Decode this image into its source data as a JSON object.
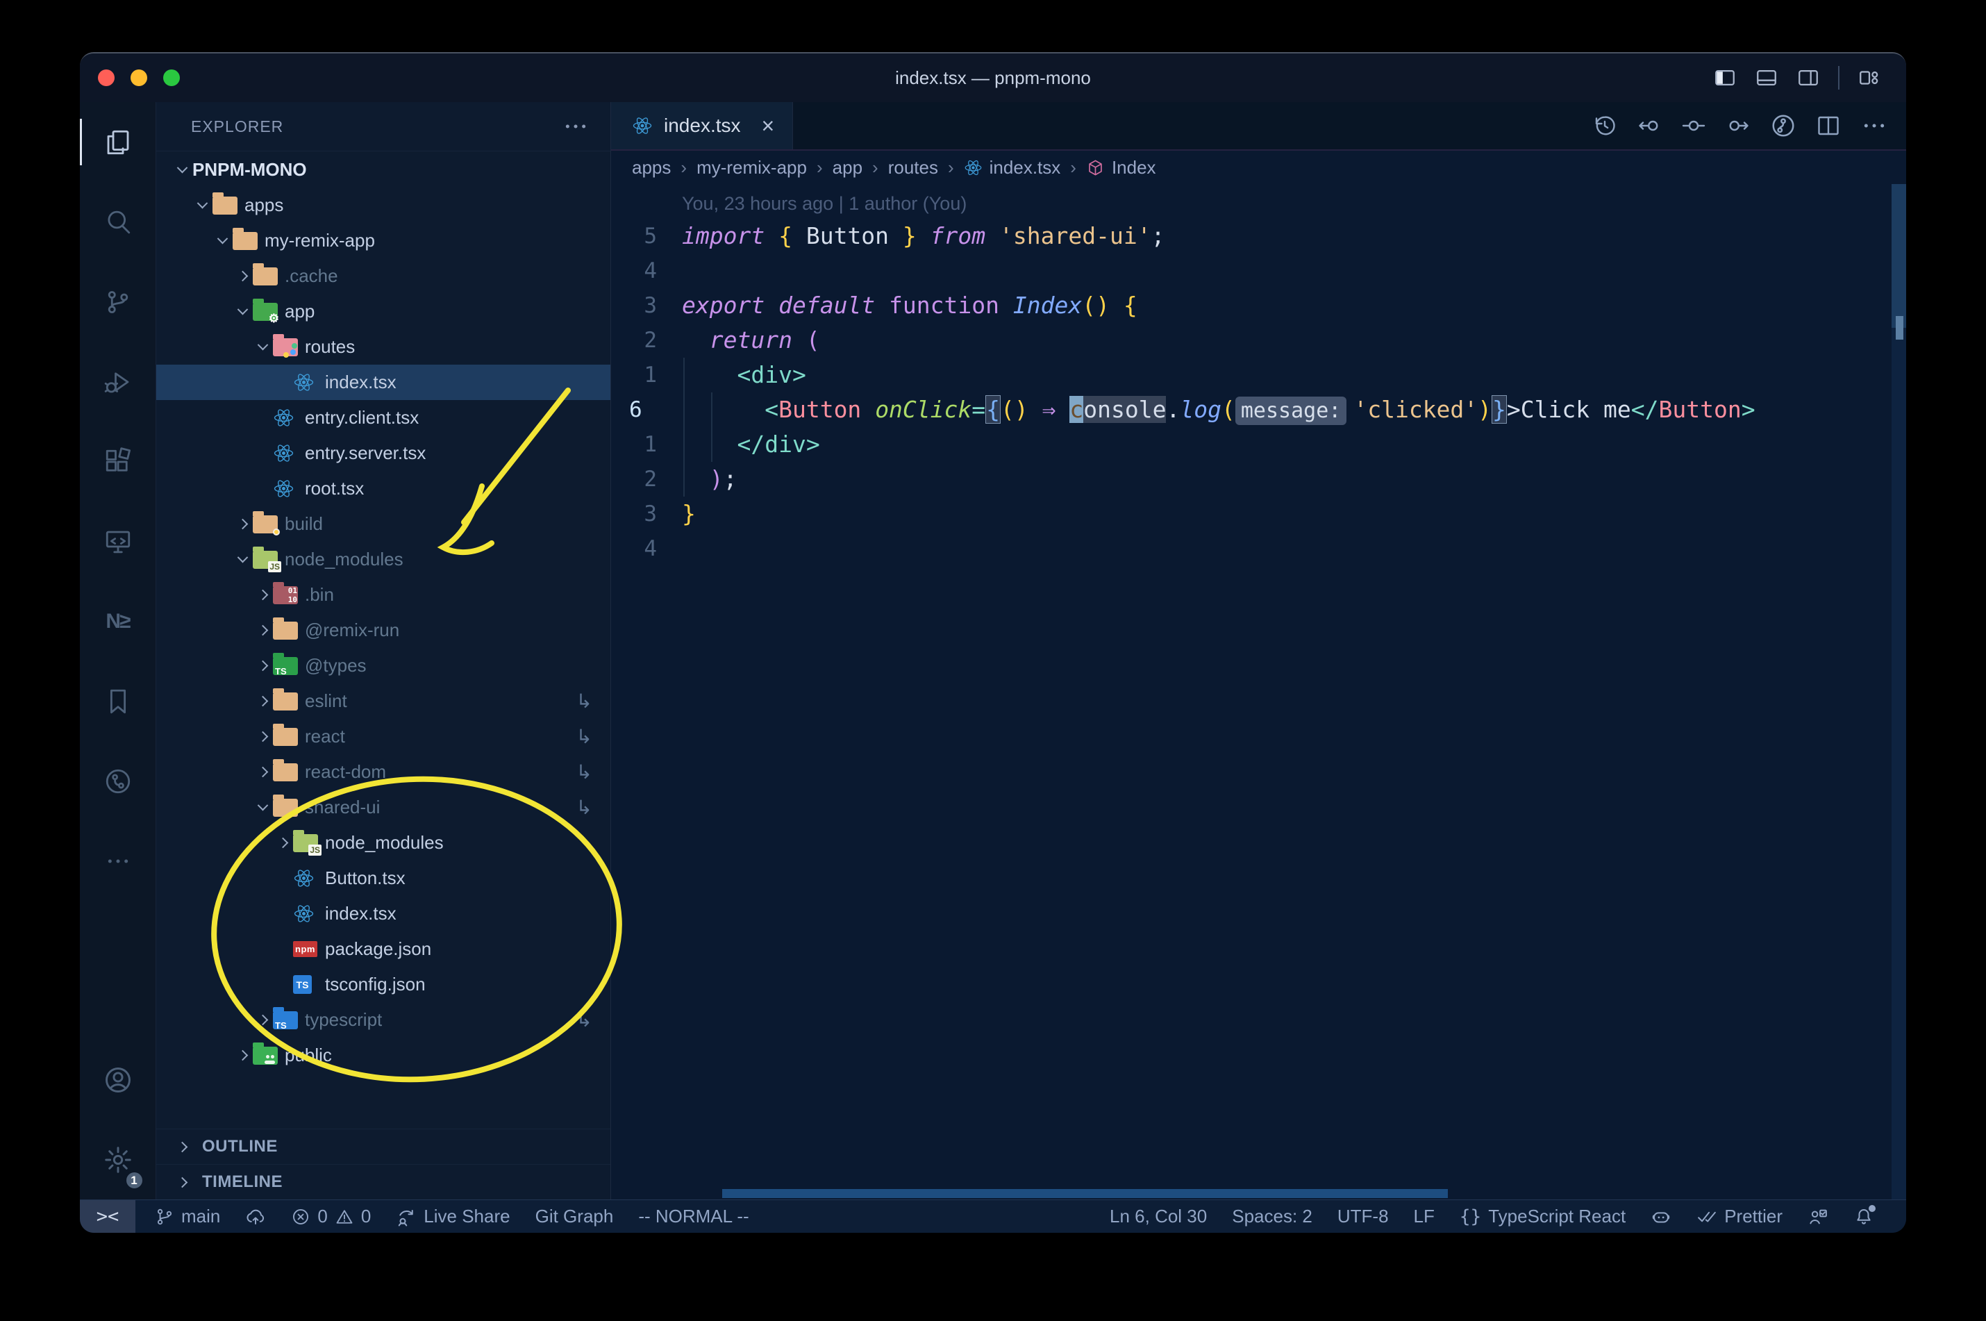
{
  "window": {
    "title": "index.tsx — pnpm-mono"
  },
  "titlebar": {
    "traffic_lights": [
      {
        "name": "close",
        "color": "#ff5f57"
      },
      {
        "name": "minimize",
        "color": "#febc2e"
      },
      {
        "name": "zoom",
        "color": "#2ac840"
      }
    ],
    "controls": [
      "layout-sidebar-left",
      "layout-panel",
      "layout-sidebar-right",
      "sep",
      "customize-layout"
    ]
  },
  "activity_bar": {
    "top": [
      {
        "name": "explorer",
        "active": true
      },
      {
        "name": "search",
        "active": false
      },
      {
        "name": "source-control",
        "active": false
      },
      {
        "name": "run-debug",
        "active": false
      },
      {
        "name": "extensions",
        "active": false
      },
      {
        "name": "remote-explorer",
        "active": false
      },
      {
        "name": "nx-console",
        "active": false
      },
      {
        "name": "bookmarks",
        "active": false
      },
      {
        "name": "gitlens",
        "active": false
      },
      {
        "name": "more",
        "active": false
      }
    ],
    "bottom": [
      {
        "name": "account"
      },
      {
        "name": "settings",
        "badge": "1"
      }
    ]
  },
  "explorer": {
    "title": "EXPLORER",
    "project": "PNPM-MONO",
    "tree": [
      {
        "label": "apps",
        "depth": 1,
        "chev": "open",
        "icon": "folder-tan",
        "dim": false,
        "sel": false,
        "symlink": false
      },
      {
        "label": "my-remix-app",
        "depth": 2,
        "chev": "open",
        "icon": "folder-tan",
        "dim": false,
        "sel": false,
        "symlink": false
      },
      {
        "label": ".cache",
        "depth": 3,
        "chev": "closed",
        "icon": "folder-tan",
        "dim": true,
        "sel": false,
        "symlink": false
      },
      {
        "label": "app",
        "depth": 3,
        "chev": "open",
        "icon": "folder-app",
        "dim": false,
        "sel": false,
        "symlink": false
      },
      {
        "label": "routes",
        "depth": 4,
        "chev": "open",
        "icon": "folder-routes",
        "dim": false,
        "sel": false,
        "symlink": false
      },
      {
        "label": "index.tsx",
        "depth": 5,
        "chev": "none",
        "icon": "react",
        "dim": false,
        "sel": true,
        "symlink": false
      },
      {
        "label": "entry.client.tsx",
        "depth": 4,
        "chev": "none",
        "icon": "react",
        "dim": false,
        "sel": false,
        "symlink": false
      },
      {
        "label": "entry.server.tsx",
        "depth": 4,
        "chev": "none",
        "icon": "react",
        "dim": false,
        "sel": false,
        "symlink": false
      },
      {
        "label": "root.tsx",
        "depth": 4,
        "chev": "none",
        "icon": "react",
        "dim": false,
        "sel": false,
        "symlink": false
      },
      {
        "label": "build",
        "depth": 3,
        "chev": "closed",
        "icon": "folder-build",
        "dim": true,
        "sel": false,
        "symlink": false
      },
      {
        "label": "node_modules",
        "depth": 3,
        "chev": "open",
        "icon": "folder-node",
        "dim": true,
        "sel": false,
        "symlink": false
      },
      {
        "label": ".bin",
        "depth": 4,
        "chev": "closed",
        "icon": "folder-bin",
        "dim": true,
        "sel": false,
        "symlink": false
      },
      {
        "label": "@remix-run",
        "depth": 4,
        "chev": "closed",
        "icon": "folder-tan",
        "dim": true,
        "sel": false,
        "symlink": false
      },
      {
        "label": "@types",
        "depth": 4,
        "chev": "closed",
        "icon": "folder-types",
        "dim": true,
        "sel": false,
        "symlink": false
      },
      {
        "label": "eslint",
        "depth": 4,
        "chev": "closed",
        "icon": "folder-tan",
        "dim": true,
        "sel": false,
        "symlink": true
      },
      {
        "label": "react",
        "depth": 4,
        "chev": "closed",
        "icon": "folder-tan",
        "dim": true,
        "sel": false,
        "symlink": true
      },
      {
        "label": "react-dom",
        "depth": 4,
        "chev": "closed",
        "icon": "folder-tan",
        "dim": true,
        "sel": false,
        "symlink": true
      },
      {
        "label": "shared-ui",
        "depth": 4,
        "chev": "open",
        "icon": "folder-tan",
        "dim": true,
        "sel": false,
        "symlink": true
      },
      {
        "label": "node_modules",
        "depth": 5,
        "chev": "closed",
        "icon": "folder-node",
        "dim": false,
        "sel": false,
        "symlink": false
      },
      {
        "label": "Button.tsx",
        "depth": 5,
        "chev": "none",
        "icon": "react",
        "dim": false,
        "sel": false,
        "symlink": false
      },
      {
        "label": "index.tsx",
        "depth": 5,
        "chev": "none",
        "icon": "react",
        "dim": false,
        "sel": false,
        "symlink": false
      },
      {
        "label": "package.json",
        "depth": 5,
        "chev": "none",
        "icon": "npm",
        "dim": false,
        "sel": false,
        "symlink": false
      },
      {
        "label": "tsconfig.json",
        "depth": 5,
        "chev": "none",
        "icon": "ts",
        "dim": false,
        "sel": false,
        "symlink": false
      },
      {
        "label": "typescript",
        "depth": 4,
        "chev": "closed",
        "icon": "folder-ts",
        "dim": true,
        "sel": false,
        "symlink": true
      },
      {
        "label": "public",
        "depth": 3,
        "chev": "closed",
        "icon": "folder-public",
        "dim": false,
        "sel": false,
        "symlink": false
      }
    ],
    "bottom_sections": [
      "OUTLINE",
      "TIMELINE"
    ]
  },
  "editor": {
    "tab": {
      "label": "index.tsx",
      "icon": "react",
      "close": "×"
    },
    "toolbar": [
      "history",
      "prev-change",
      "change",
      "next-change",
      "gitlens-graph",
      "split-editor",
      "more"
    ],
    "breadcrumbs": [
      {
        "label": "apps",
        "icon": null
      },
      {
        "label": "my-remix-app",
        "icon": null
      },
      {
        "label": "app",
        "icon": null
      },
      {
        "label": "routes",
        "icon": null
      },
      {
        "label": "index.tsx",
        "icon": "react"
      },
      {
        "label": "Index",
        "icon": "cube"
      }
    ],
    "blame": "You, 23 hours ago | 1 author (You)",
    "code_lines": [
      {
        "num": "5",
        "cur": false,
        "indent": 0,
        "tokens": [
          [
            "import",
            "kw"
          ],
          [
            " ",
            "fg"
          ],
          [
            "{",
            "y"
          ],
          [
            " Button ",
            "fg"
          ],
          [
            "}",
            "y"
          ],
          [
            " ",
            "fg"
          ],
          [
            "from",
            "kw"
          ],
          [
            " ",
            "fg"
          ],
          [
            "'shared-ui'",
            "str"
          ],
          [
            ";",
            "pun"
          ]
        ]
      },
      {
        "num": "4",
        "cur": false,
        "indent": 0,
        "tokens": []
      },
      {
        "num": "3",
        "cur": false,
        "indent": 0,
        "tokens": [
          [
            "export",
            "kw"
          ],
          [
            " ",
            "fg"
          ],
          [
            "default",
            "kw"
          ],
          [
            " ",
            "fg"
          ],
          [
            "function",
            "kwp"
          ],
          [
            " ",
            "fg"
          ],
          [
            "Index",
            "fn"
          ],
          [
            "(",
            "y"
          ],
          [
            ")",
            "y"
          ],
          [
            " ",
            "fg"
          ],
          [
            "{",
            "y"
          ]
        ]
      },
      {
        "num": "2",
        "cur": false,
        "indent": 2,
        "tokens": [
          [
            "return",
            "kw"
          ],
          [
            " ",
            "fg"
          ],
          [
            "(",
            "pk"
          ]
        ]
      },
      {
        "num": "1",
        "cur": false,
        "indent": 4,
        "tokens": [
          [
            "<",
            "tt"
          ],
          [
            "div",
            "tt"
          ],
          [
            ">",
            "tt"
          ]
        ]
      },
      {
        "num": "6",
        "cur": true,
        "indent": 6,
        "tokens": [
          [
            "<",
            "tt"
          ],
          [
            "Button",
            "rt"
          ],
          [
            " ",
            "fg"
          ],
          [
            "onClick",
            "at"
          ],
          [
            "=",
            "op"
          ],
          [
            "{",
            "bb"
          ],
          [
            "(",
            "y"
          ],
          [
            ")",
            "y"
          ],
          [
            " ",
            "fg"
          ],
          [
            "⇒",
            "arrow"
          ],
          [
            " ",
            "fg"
          ],
          [
            "c",
            "cur"
          ],
          [
            "onsole",
            "whl"
          ],
          [
            ".",
            "pun"
          ],
          [
            "log",
            "fn"
          ],
          [
            "(",
            "y"
          ],
          [
            "message:",
            "inlay"
          ],
          [
            "'clicked'",
            "str"
          ],
          [
            ")",
            "y"
          ],
          [
            "}",
            "bb"
          ],
          [
            ">",
            "fg"
          ],
          [
            "Click me",
            "fg"
          ],
          [
            "</",
            "tt"
          ],
          [
            "Button",
            "rt"
          ],
          [
            ">",
            "tt"
          ]
        ]
      },
      {
        "num": "1",
        "cur": false,
        "indent": 4,
        "tokens": [
          [
            "</",
            "tt"
          ],
          [
            "div",
            "tt"
          ],
          [
            ">",
            "tt"
          ]
        ]
      },
      {
        "num": "2",
        "cur": false,
        "indent": 2,
        "tokens": [
          [
            ")",
            "pk"
          ],
          [
            ";",
            "pun"
          ]
        ]
      },
      {
        "num": "3",
        "cur": false,
        "indent": 0,
        "tokens": [
          [
            "}",
            "y"
          ]
        ]
      },
      {
        "num": "4",
        "cur": false,
        "indent": 0,
        "tokens": []
      }
    ]
  },
  "status_bar": {
    "left": [
      {
        "name": "remote",
        "type": "remote",
        "text": "><"
      },
      {
        "name": "git-branch",
        "icon": "branch",
        "text": "main"
      },
      {
        "name": "sync",
        "icon": "cloud",
        "text": ""
      },
      {
        "name": "problems",
        "type": "problems",
        "errors": "0",
        "warnings": "0"
      },
      {
        "name": "live-share",
        "icon": "liveshare",
        "text": "Live Share"
      },
      {
        "name": "git-graph",
        "icon": null,
        "text": "Git Graph"
      },
      {
        "name": "vim-mode",
        "icon": null,
        "text": "-- NORMAL --"
      }
    ],
    "right": [
      {
        "name": "cursor-position",
        "icon": null,
        "text": "Ln 6, Col 30"
      },
      {
        "name": "indentation",
        "icon": null,
        "text": "Spaces: 2"
      },
      {
        "name": "encoding",
        "icon": null,
        "text": "UTF-8"
      },
      {
        "name": "eol",
        "icon": null,
        "text": "LF"
      },
      {
        "name": "language-mode",
        "icon": "braces",
        "text": "TypeScript React"
      },
      {
        "name": "copilot",
        "icon": "copilot",
        "text": ""
      },
      {
        "name": "prettier",
        "icon": "checks",
        "text": "Prettier"
      },
      {
        "name": "feedback",
        "icon": "personcheck",
        "text": ""
      },
      {
        "name": "notifications",
        "icon": "bell",
        "text": "",
        "dot": true
      }
    ]
  },
  "annotations": {
    "color": "#f2e535",
    "shapes": [
      "arrow-to-node-modules",
      "circle-around-shared-ui"
    ]
  }
}
